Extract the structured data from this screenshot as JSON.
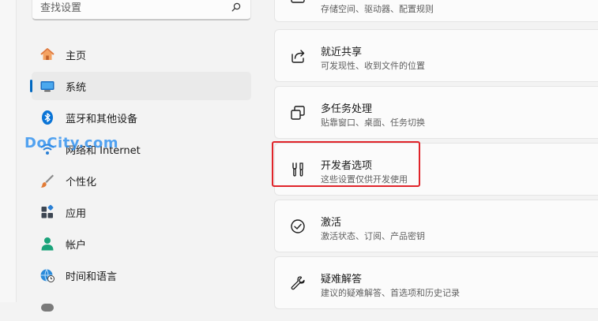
{
  "search": {
    "placeholder": "查找设置"
  },
  "nav": {
    "items": [
      {
        "label": "主页",
        "icon": "home-icon"
      },
      {
        "label": "系统",
        "icon": "system-icon",
        "selected": true
      },
      {
        "label": "蓝牙和其他设备",
        "icon": "bluetooth-icon"
      },
      {
        "label": "网络和 Internet",
        "icon": "network-icon"
      },
      {
        "label": "个性化",
        "icon": "brush-icon"
      },
      {
        "label": "应用",
        "icon": "apps-icon"
      },
      {
        "label": "帐户",
        "icon": "account-icon"
      },
      {
        "label": "时间和语言",
        "icon": "globe-clock-icon"
      }
    ]
  },
  "watermark": "DoCity.com",
  "cards": [
    {
      "title": "",
      "subtitle": "存储空间、驱动器、配置规则",
      "icon": "storage-icon"
    },
    {
      "title": "就近共享",
      "subtitle": "可发现性、收到文件的位置",
      "icon": "share-icon"
    },
    {
      "title": "多任务处理",
      "subtitle": "贴靠窗口、桌面、任务切换",
      "icon": "multitask-icon"
    },
    {
      "title": "开发者选项",
      "subtitle": "这些设置仅供开发使用",
      "icon": "developer-tools-icon"
    },
    {
      "title": "激活",
      "subtitle": "激活状态、订阅、产品密钥",
      "icon": "activation-check-icon"
    },
    {
      "title": "疑难解答",
      "subtitle": "建议的疑难解答、首选项和历史记录",
      "icon": "wrench-icon"
    }
  ],
  "colors": {
    "accent": "#0067c0",
    "highlight_box": "#e0242a",
    "watermark": "#2b8ff0"
  }
}
